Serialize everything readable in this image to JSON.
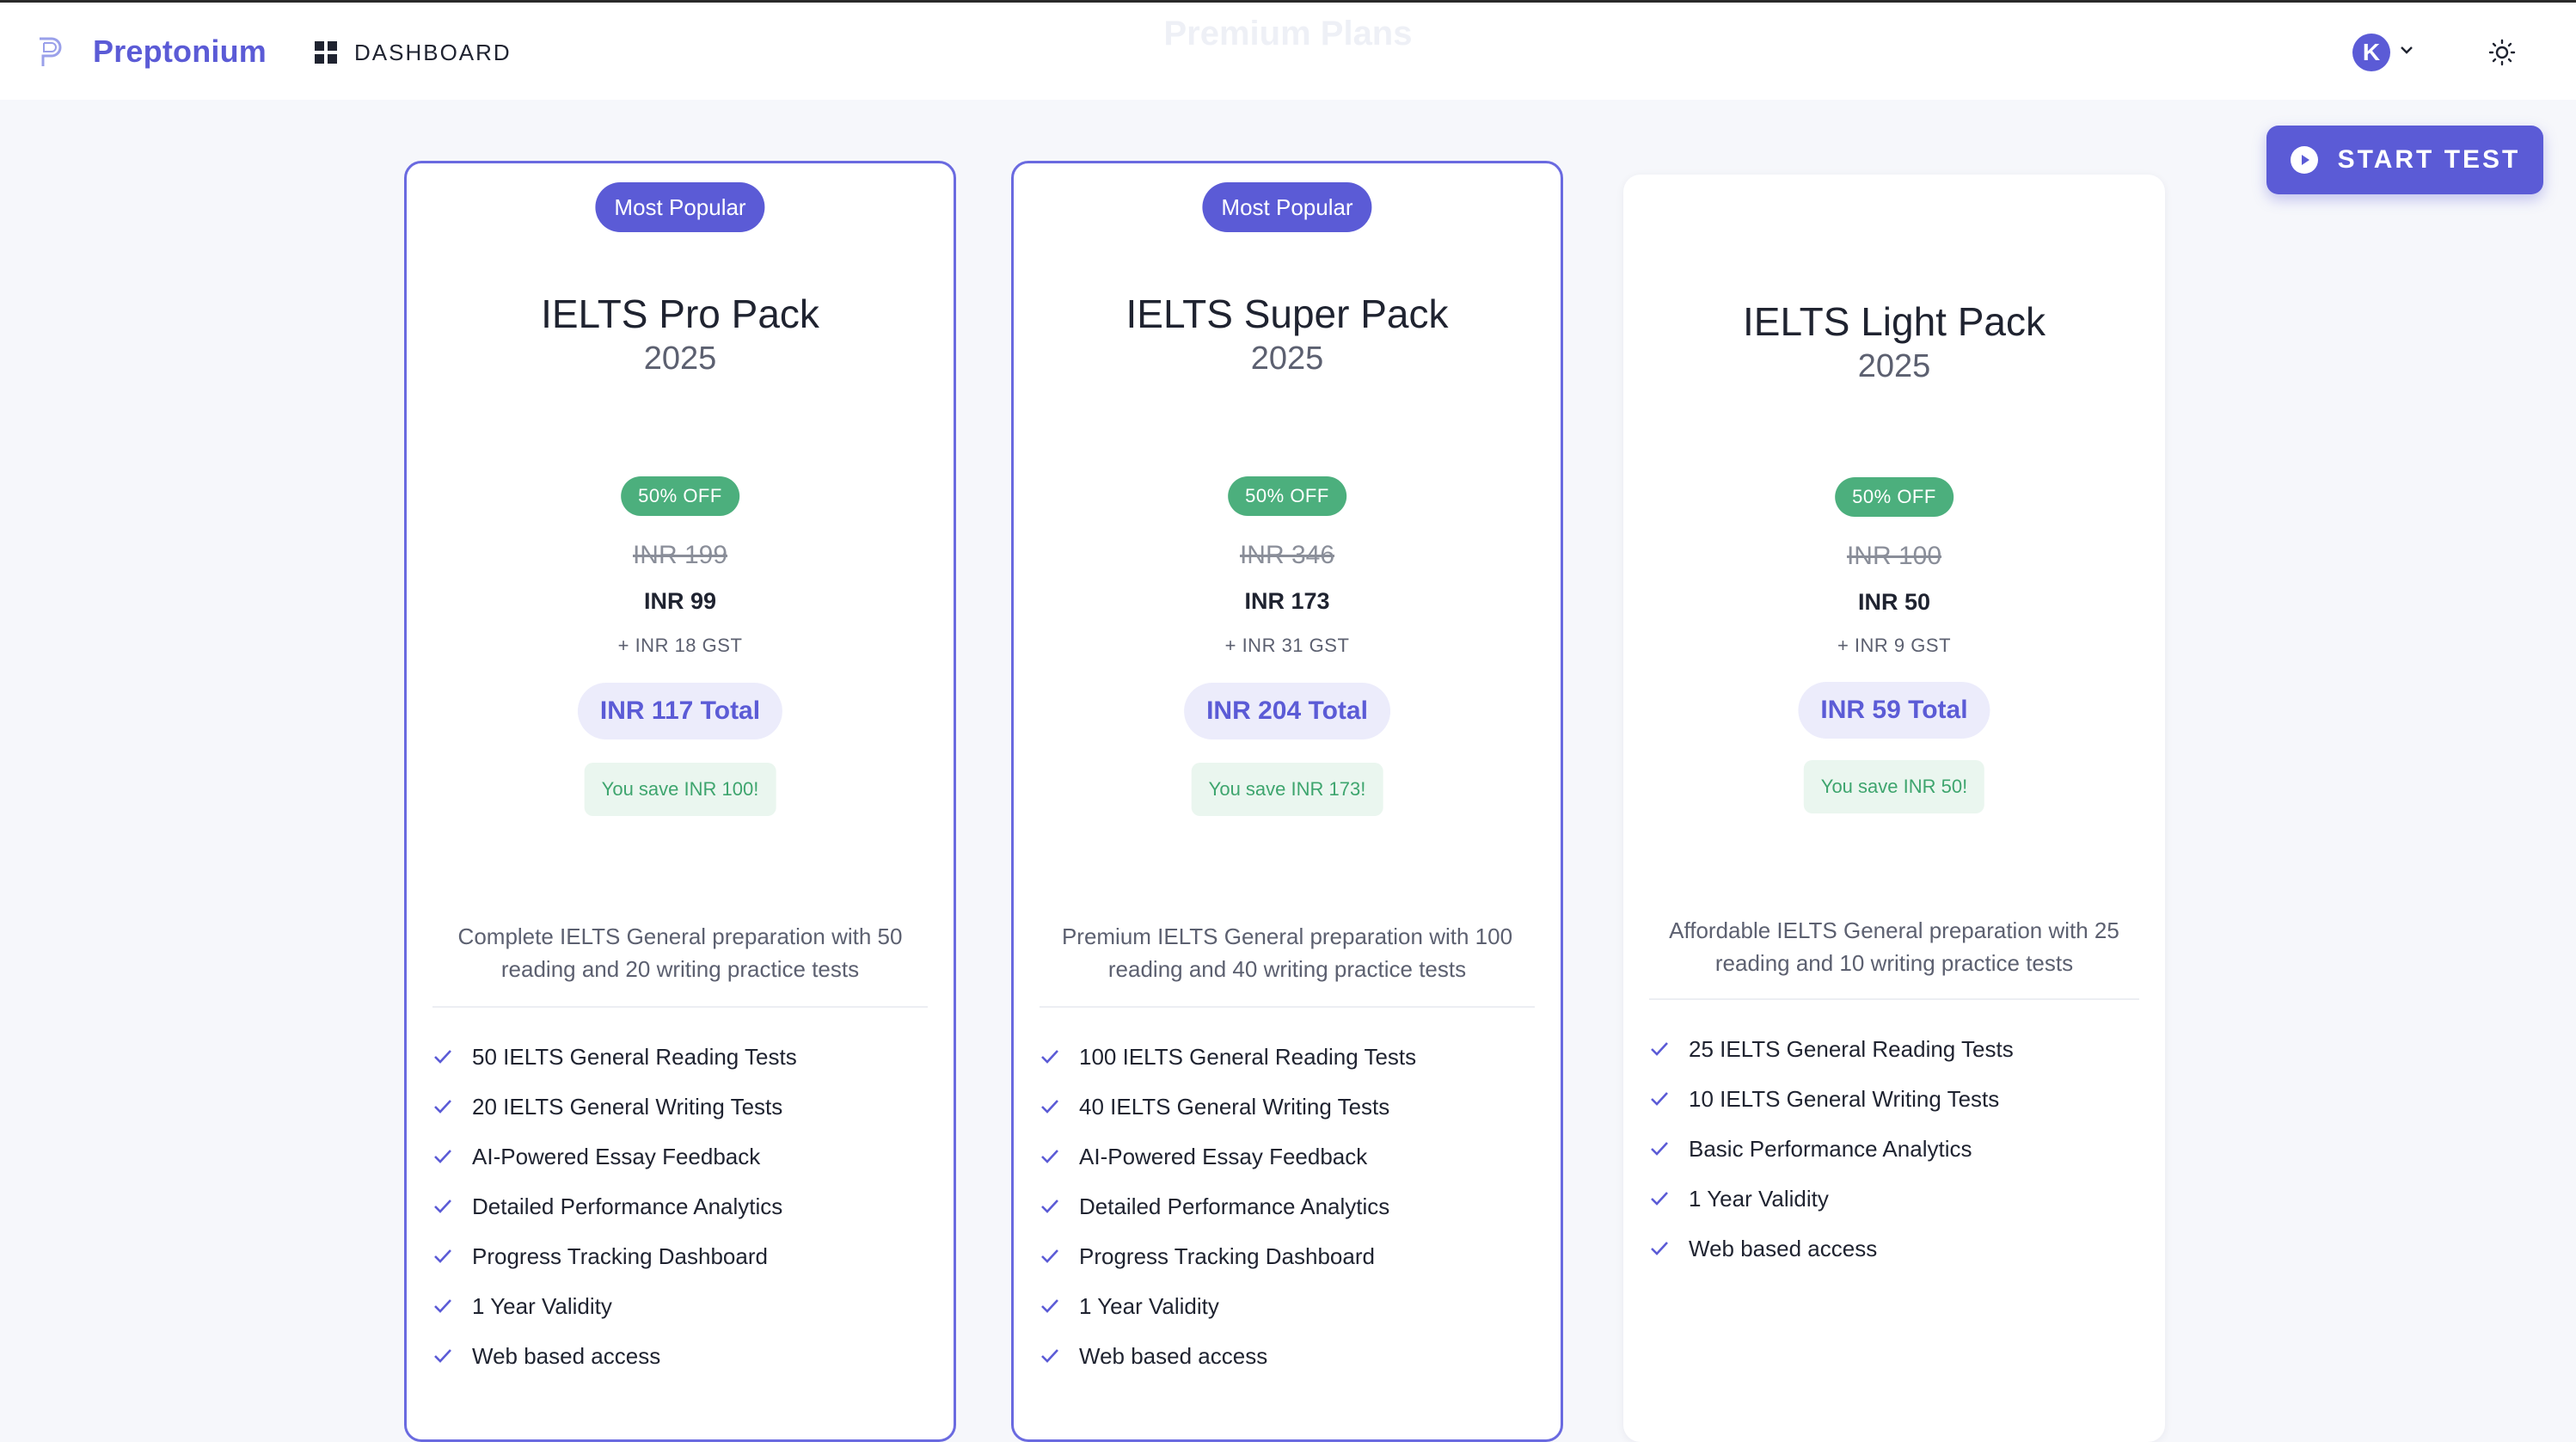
{
  "header": {
    "brand": "Preptonium",
    "nav_dashboard": "DASHBOARD",
    "page_title": "Premium Plans",
    "avatar_initial": "K"
  },
  "actions": {
    "start_test_label": "START TEST"
  },
  "colors": {
    "accent": "#5b5bd6",
    "discount": "#4caf7d",
    "savings": "#3ea56e"
  },
  "plans": [
    {
      "badge": "Most Popular",
      "name": "IELTS Pro Pack",
      "year": "2025",
      "discount": "50% OFF",
      "original_price": "INR 199",
      "price": "INR 99",
      "gst": "+ INR 18 GST",
      "total": "INR 117 Total",
      "savings": "You save INR 100!",
      "description": "Complete IELTS General preparation with 50 reading and 20 writing practice tests",
      "features": [
        "50 IELTS General Reading Tests",
        "20 IELTS General Writing Tests",
        "AI-Powered Essay Feedback",
        "Detailed Performance Analytics",
        "Progress Tracking Dashboard",
        "1 Year Validity",
        "Web based access"
      ]
    },
    {
      "badge": "Most Popular",
      "name": "IELTS Super Pack",
      "year": "2025",
      "discount": "50% OFF",
      "original_price": "INR 346",
      "price": "INR 173",
      "gst": "+ INR 31 GST",
      "total": "INR 204 Total",
      "savings": "You save INR 173!",
      "description": "Premium IELTS General preparation with 100 reading and 40 writing practice tests",
      "features": [
        "100 IELTS General Reading Tests",
        "40 IELTS General Writing Tests",
        "AI-Powered Essay Feedback",
        "Detailed Performance Analytics",
        "Progress Tracking Dashboard",
        "1 Year Validity",
        "Web based access"
      ]
    },
    {
      "name": "IELTS Light Pack",
      "year": "2025",
      "discount": "50% OFF",
      "original_price": "INR 100",
      "price": "INR 50",
      "gst": "+ INR 9 GST",
      "total": "INR 59 Total",
      "savings": "You save INR 50!",
      "description": "Affordable IELTS General preparation with 25 reading and 10 writing practice tests",
      "features": [
        "25 IELTS General Reading Tests",
        "10 IELTS General Writing Tests",
        "Basic Performance Analytics",
        "1 Year Validity",
        "Web based access"
      ]
    }
  ]
}
